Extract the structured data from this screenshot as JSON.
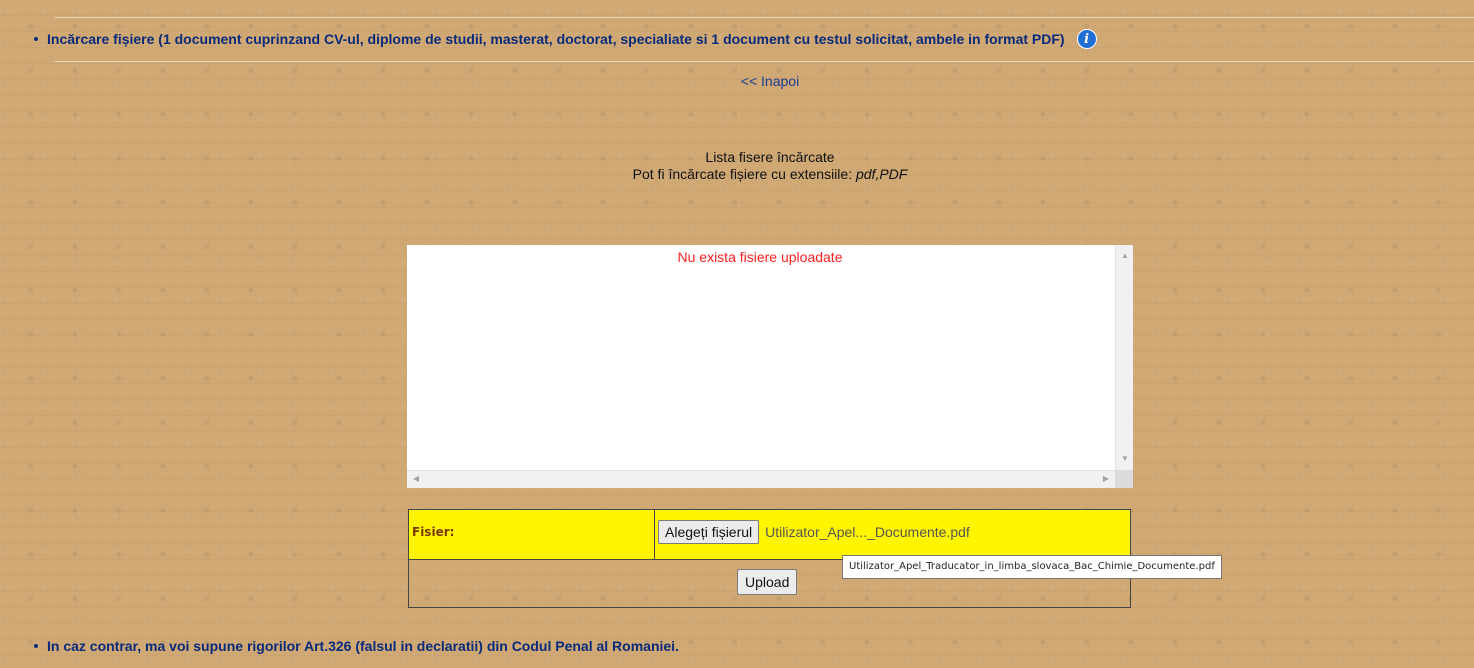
{
  "section": {
    "title": "Incărcare fișiere (1 document cuprinzand CV-ul, diplome de studii, masterat, doctorat, specialiate si 1 document cu testul solicitat, ambele in format PDF)",
    "info_icon": "info-icon"
  },
  "nav": {
    "back_label": "<< Inapoi"
  },
  "file_list": {
    "title": "Lista fisere încărcate",
    "note_prefix": "Pot fi încărcate fișiere cu extensiile: ",
    "extensions": "pdf,PDF",
    "empty_message": "Nu exista fisiere uploadate"
  },
  "upload_form": {
    "label": "Fisier:",
    "choose_button": "Alegeți fișierul",
    "selected_file_display": "Utilizator_Apel..._Documente.pdf",
    "selected_file_full": "Utilizator_Apel_Traducator_in_limba_slovaca_Bac_Chimie_Documente.pdf",
    "upload_button": "Upload"
  },
  "footer_note": "In caz contrar, ma voi supune rigorilor Art.326 (falsul in declaratii) din Codul Penal al Romaniei.",
  "colors": {
    "background": "#cfa874",
    "link": "#1a3d91",
    "heading": "#0a2a7a",
    "error": "#ff1f1f",
    "form_row": "#fff500"
  }
}
